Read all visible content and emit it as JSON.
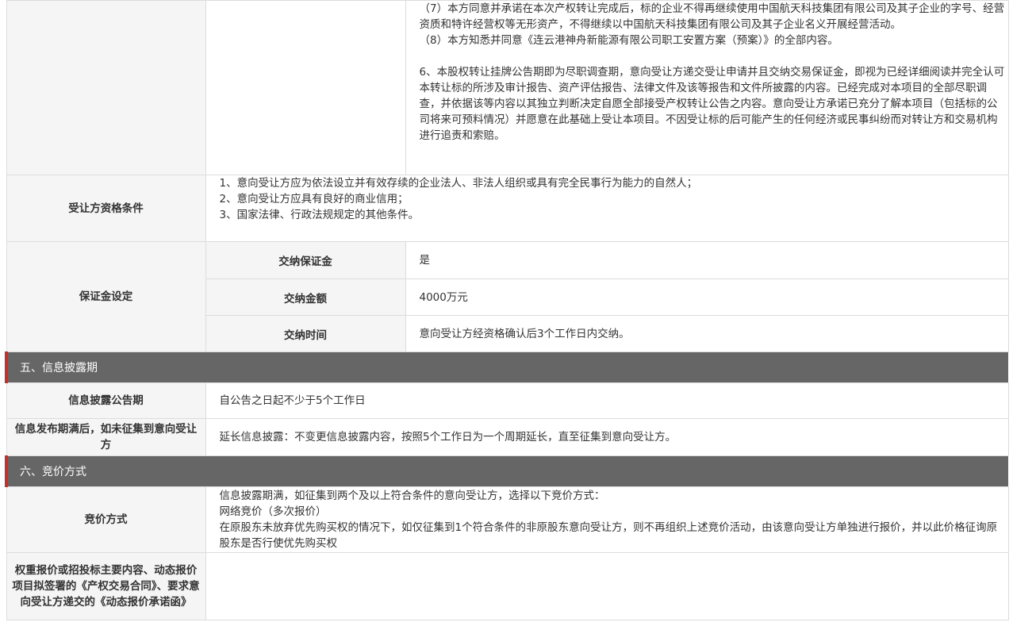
{
  "top_block": {
    "p1": "（7）本方同意并承诺在本次产权转让完成后，标的企业不得再继续使用中国航天科技集团有限公司及其子企业的字号、经营资质和特许经营权等无形资产，不得继续以中国航天科技集团有限公司及其子企业名义开展经营活动。",
    "p2": "（8）本方知悉并同意《连云港神舟新能源有限公司职工安置方案（预案）》的全部内容。",
    "p3": "6、本股权转让挂牌公告期即为尽职调查期，意向受让方递交受让申请并且交纳交易保证金，即视为已经详细阅读并完全认可本转让标的所涉及审计报告、资产评估报告、法律文件及该等报告和文件所披露的内容。已经完成对本项目的全部尽职调查，并依据该等内容以其独立判断决定自愿全部接受产权转让公告之内容。意向受让方承诺已充分了解本项目（包括标的公司将来可预料情况）并愿意在此基础上受让本项目。不因受让标的后可能产生的任何经济或民事纠纷而对转让方和交易机构进行追责和索赔。"
  },
  "qualification": {
    "label": "受让方资格条件",
    "lines": [
      "1、意向受让方应为依法设立并有效存续的企业法人、非法人组织或具有完全民事行为能力的自然人；",
      "2、意向受让方应具有良好的商业信用；",
      "3、国家法律、行政法规规定的其他条件。"
    ]
  },
  "deposit": {
    "label": "保证金设定",
    "rows": [
      {
        "label": "交纳保证金",
        "value": "是"
      },
      {
        "label": "交纳金额",
        "value": "4000万元"
      },
      {
        "label": "交纳时间",
        "value": "意向受让方经资格确认后3个工作日内交纳。"
      }
    ]
  },
  "section5": {
    "title": "五、信息披露期",
    "period_label": "信息披露公告期",
    "period_value": "自公告之日起不少于5个工作日",
    "expire_label": "信息发布期满后，如未征集到意向受让方",
    "expire_value": "延长信息披露：不变更信息披露内容，按照5个工作日为一个周期延长，直至征集到意向受让方。"
  },
  "section6": {
    "title": "六、竞价方式",
    "method_label": "竞价方式",
    "method_lines": [
      "信息披露期满，如征集到两个及以上符合条件的意向受让方，选择以下竞价方式：",
      "网络竞价（多次报价）",
      "在原股东未放弃优先购买权的情况下，如仅征集到1个符合条件的非原股东意向受让方，则不再组织上述竞价活动，由该意向受让方单独进行报价，并以此价格征询原股东是否行使优先购买权"
    ],
    "contract_label": "权重报价或招投标主要内容、动态报价项目拟签署的《产权交易合同》、要求意向受让方递交的《动态报价承诺函》",
    "contract_value": ""
  },
  "colors": {
    "section_bar": "#666666",
    "section_accent": "#c5302a",
    "label_bg": "#f5f5f5",
    "border": "#dcdcdc"
  }
}
